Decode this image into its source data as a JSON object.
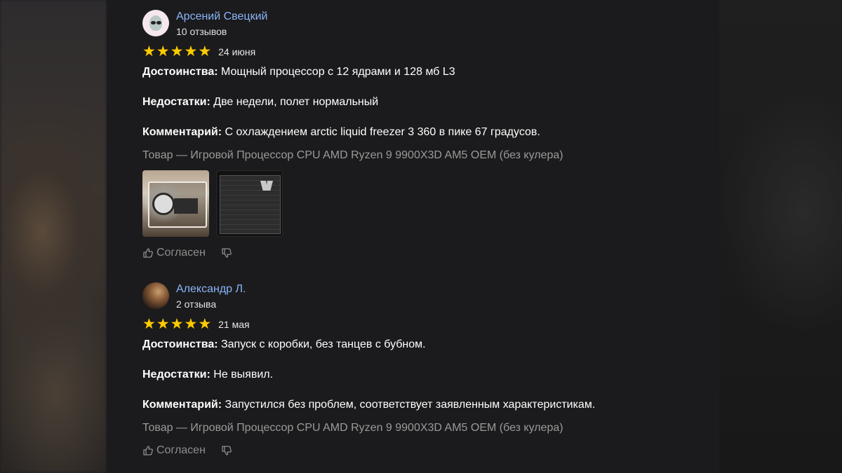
{
  "reviews": [
    {
      "author": "Арсений Свецкий",
      "review_count": "10 отзывов",
      "rating": 5,
      "date": "24 июня",
      "pros_label": "Достоинства:",
      "pros": " Мощный процессор с 12 ядрами и 128 мб L3",
      "cons_label": "Недостатки:",
      "cons": " Две недели, полет нормальный",
      "comment_label": "Комментарий:",
      "comment": " С охлаждением arctic liquid freezer 3 360 в пике 67 градусов.",
      "product": "Товар — Игровой Процессор CPU AMD Ryzen 9 9900X3D AM5 OEM (без кулера)",
      "agree_label": "Согласен"
    },
    {
      "author": "Александр Л.",
      "review_count": "2 отзыва",
      "rating": 5,
      "date": "21 мая",
      "pros_label": "Достоинства:",
      "pros": " Запуск с коробки, без танцев с бубном.",
      "cons_label": "Недостатки:",
      "cons": " Не выявил.",
      "comment_label": "Комментарий:",
      "comment": " Запустился без проблем, соответствует заявленным характеристикам.",
      "product": "Товар — Игровой Процессор CPU AMD Ryzen 9 9900X3D AM5 OEM (без кулера)",
      "agree_label": "Согласен"
    }
  ],
  "colors": {
    "background": "#1b1b1d",
    "author_link": "#8ab4f8",
    "star": "#ffcc00",
    "muted_text": "#9a9a9a"
  },
  "icons": {
    "star": "star-icon",
    "like": "thumbs-up-icon",
    "dislike": "thumbs-down-icon"
  }
}
